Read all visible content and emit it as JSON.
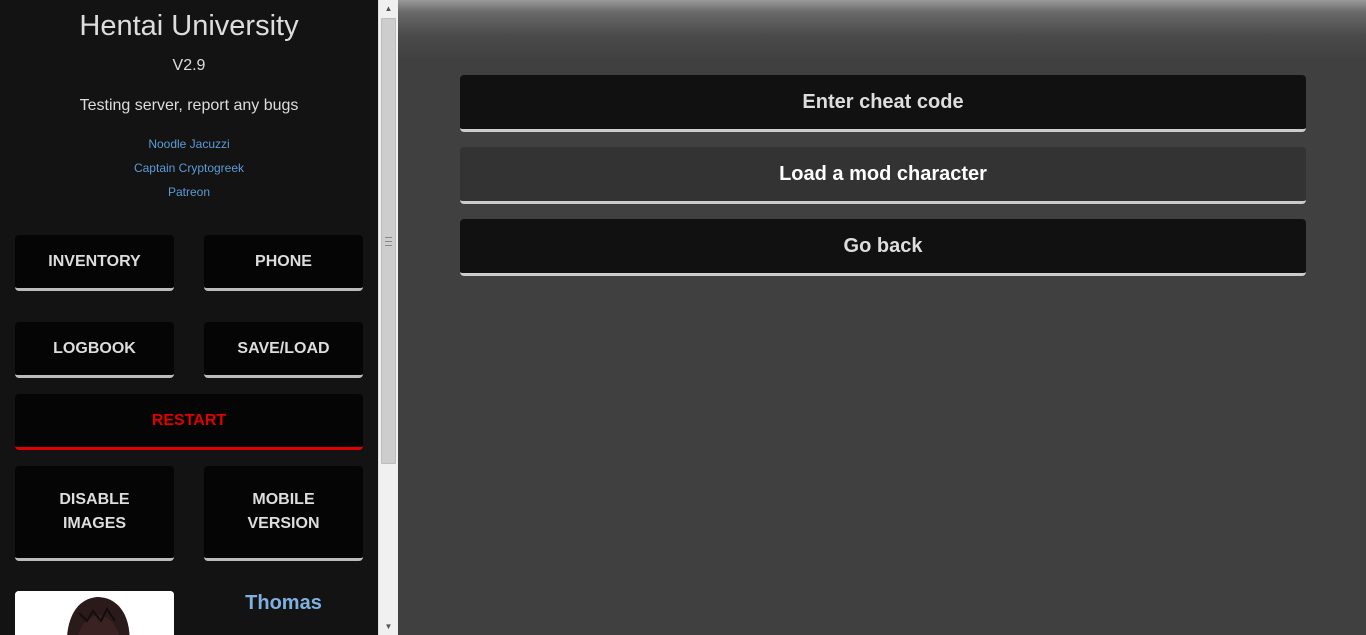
{
  "sidebar": {
    "title": "Hentai University",
    "version": "V2.9",
    "note": "Testing server, report any bugs",
    "links": [
      "Noodle Jacuzzi",
      "Captain Cryptogreek",
      "Patreon"
    ],
    "buttons": {
      "inventory": "INVENTORY",
      "phone": "PHONE",
      "logbook": "LOGBOOK",
      "saveload": "SAVE/LOAD",
      "restart": "RESTART",
      "disable_images": "DISABLE IMAGES",
      "mobile_version": "MOBILE VERSION"
    },
    "character_name": "Thomas"
  },
  "main": {
    "buttons": [
      "Enter cheat code",
      "Load a mod character",
      "Go back"
    ]
  },
  "colors": {
    "accent_link": "#5b9bd5",
    "restart_red": "#e00000",
    "character_name": "#7fb0e0"
  }
}
